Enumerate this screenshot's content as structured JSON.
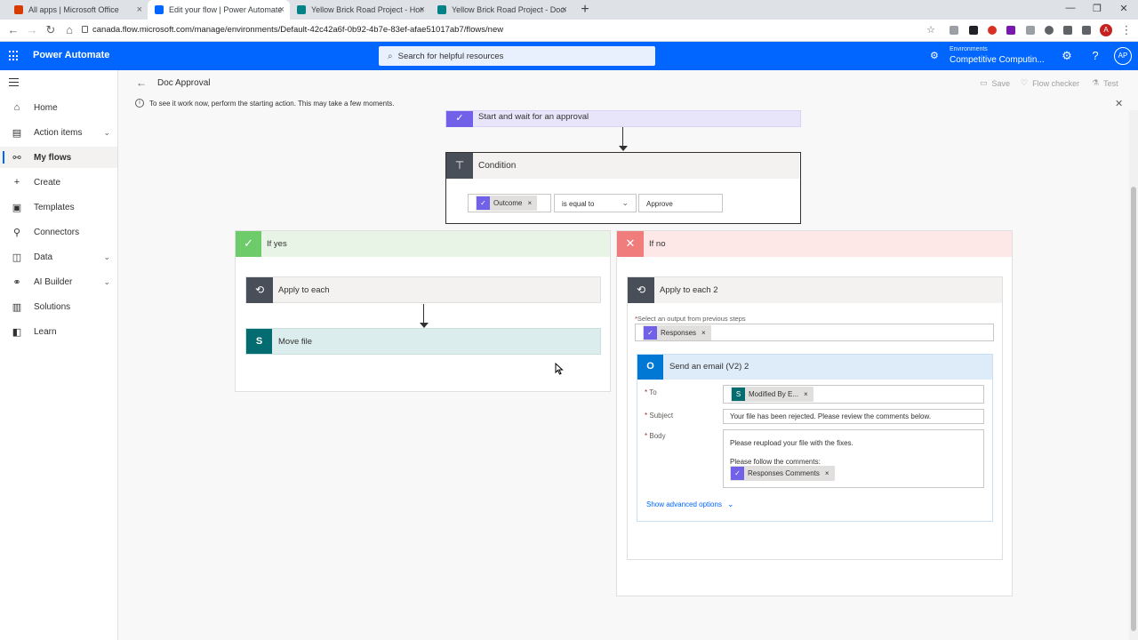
{
  "browser": {
    "tabs": [
      {
        "title": "All apps | Microsoft Office",
        "color": "#d83b01"
      },
      {
        "title": "Edit your flow | Power Automate",
        "color": "#0066ff"
      },
      {
        "title": "Yellow Brick Road Project - Home",
        "color": "#038387"
      },
      {
        "title": "Yellow Brick Road Project - Docu",
        "color": "#038387"
      }
    ],
    "url": "canada.flow.microsoft.com/manage/environments/Default-42c42a6f-0b92-4b7e-83ef-afae51017ab7/flows/new",
    "profile_initial": "A"
  },
  "header": {
    "app_title": "Power Automate",
    "search_placeholder": "Search for helpful resources",
    "env_label": "Environments",
    "env_name": "Competitive Computin...",
    "avatar_initials": "AP"
  },
  "nav": {
    "items": [
      {
        "label": "Home",
        "icon": "home-icon",
        "glyph": "⌂"
      },
      {
        "label": "Action items",
        "icon": "clipboard-icon",
        "glyph": "▤",
        "chevron": true
      },
      {
        "label": "My flows",
        "icon": "flows-icon",
        "glyph": "⚯",
        "selected": true
      },
      {
        "label": "Create",
        "icon": "plus-icon",
        "glyph": "+"
      },
      {
        "label": "Templates",
        "icon": "templates-icon",
        "glyph": "▣"
      },
      {
        "label": "Connectors",
        "icon": "connector-icon",
        "glyph": "⚲"
      },
      {
        "label": "Data",
        "icon": "database-icon",
        "glyph": "◫",
        "chevron": true
      },
      {
        "label": "AI Builder",
        "icon": "ai-builder-icon",
        "glyph": "⚭",
        "chevron": true
      },
      {
        "label": "Solutions",
        "icon": "solutions-icon",
        "glyph": "▥"
      },
      {
        "label": "Learn",
        "icon": "book-icon",
        "glyph": "◧"
      }
    ]
  },
  "commandbar": {
    "flow_name": "Doc Approval",
    "save": "Save",
    "flow_checker": "Flow checker",
    "test": "Test",
    "info": "To see it work now, perform the starting action. This may take a few moments."
  },
  "flow": {
    "approval_step": "Start and wait for an approval",
    "condition": {
      "title": "Condition",
      "left_token": "Outcome",
      "operator": "is equal to",
      "value": "Approve"
    },
    "if_yes": {
      "label": "If yes",
      "apply_each": "Apply to each",
      "move_file": "Move file"
    },
    "if_no": {
      "label": "If no",
      "apply_each": "Apply to each 2",
      "select_output_label": "Select an output from previous steps",
      "select_output_token": "Responses",
      "email": {
        "title": "Send an email (V2) 2",
        "to_label": "To",
        "to_token": "Modified By E...",
        "subject_label": "Subject",
        "subject_value": "Your file has been rejected. Please review the comments below.",
        "body_label": "Body",
        "body_line1": "Please reupload your file with the fixes.",
        "body_line2": "Please follow the comments:",
        "body_token": "Responses Comments",
        "advanced": "Show advanced options"
      }
    }
  },
  "colors": {
    "brand": "#0066ff",
    "approval": "#7160e8",
    "control": "#484f58",
    "yes": "#6dcb6a",
    "no": "#f07c7c",
    "sharepoint": "#036c70",
    "outlook": "#0078d4"
  }
}
